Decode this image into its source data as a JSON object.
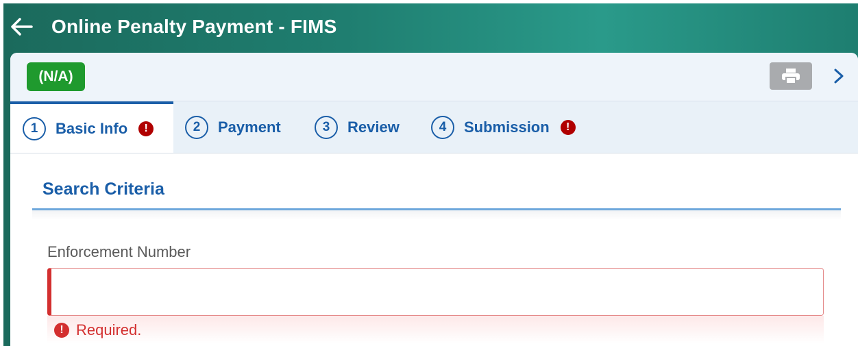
{
  "header": {
    "title": "Online Penalty Payment - FIMS",
    "back_icon": "arrow-left-icon"
  },
  "toolbar": {
    "status_badge": "(N/A)",
    "print_icon": "print-icon",
    "next_icon": "chevron-right-icon"
  },
  "tabs": [
    {
      "number": "1",
      "label": "Basic Info",
      "error": "!"
    },
    {
      "number": "2",
      "label": "Payment"
    },
    {
      "number": "3",
      "label": "Review"
    },
    {
      "number": "4",
      "label": "Submission",
      "error": "!"
    }
  ],
  "section": {
    "title": "Search Criteria"
  },
  "form": {
    "field_label": "Enforcement Number",
    "field_value": "",
    "error_icon": "!",
    "error_text": "Required."
  },
  "colors": {
    "accent": "#1a5ea8",
    "badge": "#1f9a2e",
    "error": "#d32f2f",
    "header_bg": "#1f7e70"
  }
}
